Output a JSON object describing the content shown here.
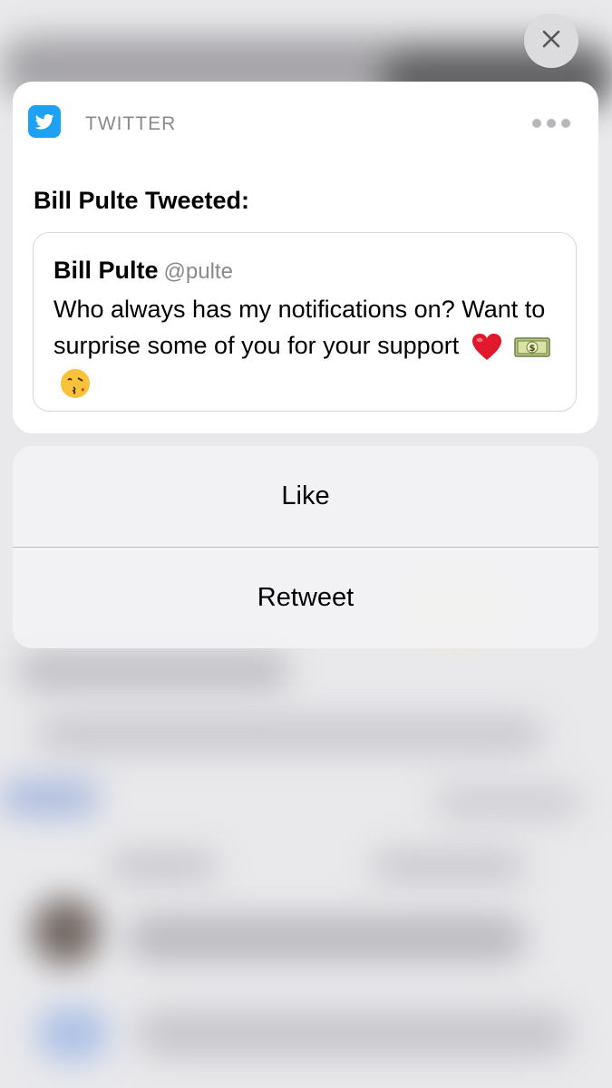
{
  "notification": {
    "app_name": "TWITTER",
    "headline": "Bill Pulte Tweeted:",
    "tweet": {
      "author": "Bill Pulte",
      "handle": "@pulte",
      "text": "Who always has my notifications on? Want to surprise some of you for your support",
      "emojis": [
        "heart-emoji",
        "money-emoji",
        "kiss-face-emoji"
      ]
    }
  },
  "actions": {
    "like_label": "Like",
    "retweet_label": "Retweet"
  },
  "icons": {
    "close": "close-icon",
    "app": "twitter-bird-icon",
    "more": "more-dots-icon"
  },
  "colors": {
    "twitter_blue": "#1da1f2"
  }
}
